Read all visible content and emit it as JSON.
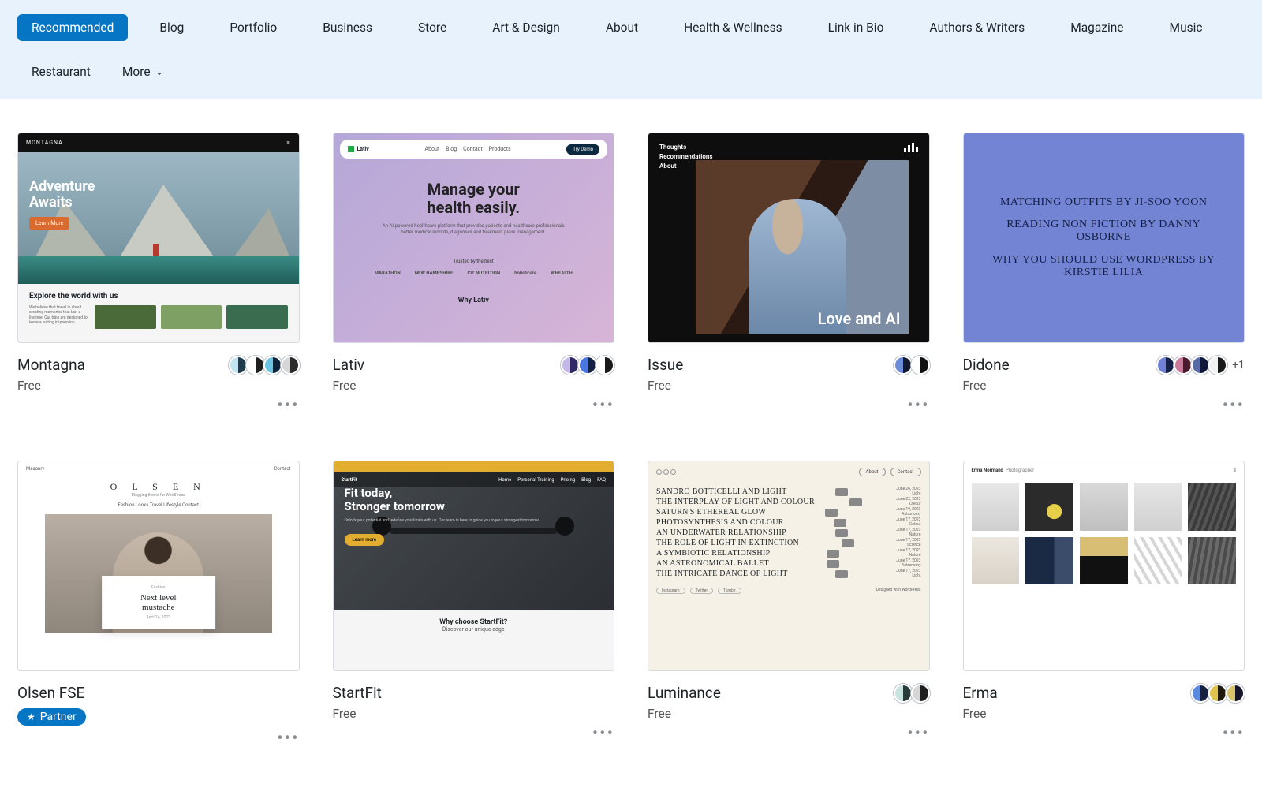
{
  "filters": {
    "items": [
      "Recommended",
      "Blog",
      "Portfolio",
      "Business",
      "Store",
      "Art & Design",
      "About",
      "Health & Wellness",
      "Link in Bio",
      "Authors & Writers",
      "Magazine",
      "Music",
      "Restaurant"
    ],
    "active_index": 0,
    "more_label": "More"
  },
  "themes": [
    {
      "name": "Montagna",
      "price": "Free",
      "swatches": [
        {
          "l": "#c2e4f2",
          "r": "#1e3a4b"
        },
        {
          "l": "#ffffff",
          "r": "#1f1f1f"
        },
        {
          "l": "#6cc4e0",
          "r": "#0d243a"
        },
        {
          "l": "#d6d6d6",
          "r": "#2b2b2b"
        }
      ],
      "thumb": {
        "brand": "MONTAGNA",
        "headline": "Adventure\nAwaits",
        "cta": "Learn More",
        "sub": "Explore the world with us"
      }
    },
    {
      "name": "Lativ",
      "price": "Free",
      "swatches": [
        {
          "l": "#c4b7ea",
          "r": "#2f2a66"
        },
        {
          "l": "#4a77e0",
          "r": "#142046"
        },
        {
          "l": "#ffffff",
          "r": "#1a1a1a"
        }
      ],
      "thumb": {
        "brand": "Lativ",
        "nav": [
          "About",
          "Blog",
          "Contact",
          "Products"
        ],
        "cta": "Try Demo",
        "headline": "Manage your\nhealth easily.",
        "sub": "An AI-powered healthcare platform that provides patients and healthcare professionals better medical records, diagnoses and treatment plans management.",
        "trusted": "Trusted by the best",
        "logos": [
          "MARATHON",
          "NEW HAMPSHIRE",
          "CIT NUTRITION",
          "holisticare",
          "WHEALTH"
        ],
        "why": "Why Lativ"
      }
    },
    {
      "name": "Issue",
      "price": "Free",
      "swatches": [
        {
          "l": "#6c8bd8",
          "r": "#12192e"
        },
        {
          "l": "#ffffff",
          "r": "#111111"
        }
      ],
      "thumb": {
        "menu": [
          "Thoughts",
          "Recommendations",
          "About"
        ],
        "caption": "Love and AI"
      }
    },
    {
      "name": "Didone",
      "price": "Free",
      "swatches": [
        {
          "l": "#6f82d6",
          "r": "#162148"
        },
        {
          "l": "#c97a9a",
          "r": "#4a1a2c"
        },
        {
          "l": "#5a6aa8",
          "r": "#10193a"
        },
        {
          "l": "#f2f2f2",
          "r": "#1a1a1a"
        }
      ],
      "swatch_more": "+1",
      "thumb": {
        "headlines": [
          "MATCHING OUTFITS BY JI-SOO YOON",
          "READING NON FICTION BY DANNY OSBORNE",
          "WHY YOU SHOULD USE WORDPRESS BY KIRSTIE LILIA"
        ]
      }
    },
    {
      "name": "Olsen FSE",
      "price": null,
      "partner_label": "Partner",
      "swatches": [],
      "thumb": {
        "top": [
          "Masonry",
          "Contact"
        ],
        "brand": "O L S E N",
        "tagline": "Blogging theme for WordPress",
        "nav": "Fashion   Looks   Travel   Lifestyle   Contact",
        "card_cat": "Fashion",
        "card_title": "Next level mustache",
        "card_date": "April 24, 2023"
      }
    },
    {
      "name": "StartFit",
      "price": "Free",
      "swatches": [],
      "thumb": {
        "brand": "StartFit",
        "nav": [
          "Home",
          "Personal Training",
          "Pricing",
          "Blog",
          "FAQ"
        ],
        "headline": "Fit today,\nStronger tomorrow",
        "sub": "Unlock your potential and redefine your limits with us. Our team is here to guide you to your strongest tomorrow.",
        "cta": "Learn more",
        "why": "Why choose StartFit?",
        "why_sub": "Discover our unique edge"
      }
    },
    {
      "name": "Luminance",
      "price": "Free",
      "swatches": [
        {
          "l": "#c9e3df",
          "r": "#2a3c3a"
        },
        {
          "l": "#d6d6d6",
          "r": "#1f1f1f"
        }
      ],
      "thumb": {
        "nav_buttons": [
          "About",
          "Contact"
        ],
        "posts": [
          {
            "t": "SANDRO BOTTICELLI AND LIGHT",
            "d": "June 26, 2023",
            "c": "Light"
          },
          {
            "t": "THE INTERPLAY OF LIGHT AND COLOUR",
            "d": "June 22, 2023",
            "c": "Colour"
          },
          {
            "t": "SATURN'S ETHEREAL GLOW",
            "d": "June 19, 2023",
            "c": "Astronomy"
          },
          {
            "t": "PHOTOSYNTHESIS AND COLOUR",
            "d": "June 17, 2023",
            "c": "Colour"
          },
          {
            "t": "AN UNDERWATER RELATIONSHIP",
            "d": "June 17, 2023",
            "c": "Nature"
          },
          {
            "t": "THE ROLE OF LIGHT IN EXTINCTION",
            "d": "June 17, 2023",
            "c": "Science"
          },
          {
            "t": "A SYMBIOTIC RELATIONSHIP",
            "d": "June 17, 2023",
            "c": "Nature"
          },
          {
            "t": "AN ASTRONOMICAL BALLET",
            "d": "June 17, 2023",
            "c": "Astronomy"
          },
          {
            "t": "THE INTRICATE DANCE OF LIGHT",
            "d": "June 17, 2023",
            "c": "Light"
          }
        ],
        "tags": [
          "Instagram",
          "Twitter",
          "Tumblr"
        ],
        "footer": "Designed with WordPress"
      }
    },
    {
      "name": "Erma",
      "price": "Free",
      "swatches": [
        {
          "l": "#5b8be0",
          "r": "#16213f"
        },
        {
          "l": "#e0c24e",
          "r": "#1f1a0a"
        },
        {
          "l": "#d8c46a",
          "r": "#14142a"
        }
      ],
      "thumb": {
        "brand": "Erma Normand",
        "role": "Photographer"
      }
    }
  ]
}
